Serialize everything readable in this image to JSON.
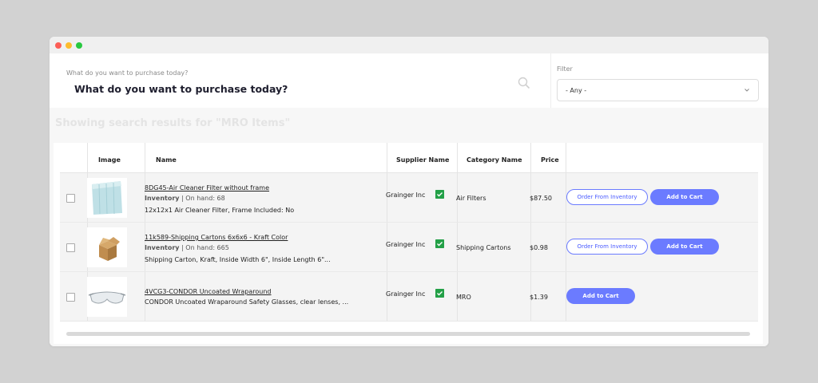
{
  "window": {
    "controls": [
      {
        "name": "close",
        "color": "#fc5e57"
      },
      {
        "name": "minimize",
        "color": "#fdbc2e"
      },
      {
        "name": "zoom",
        "color": "#28c840"
      }
    ]
  },
  "search": {
    "label": "What do you want to purchase today?",
    "value": "What do you want to purchase today?",
    "icon": "search-icon"
  },
  "filter": {
    "label": "Filter",
    "selected": "- Any -"
  },
  "results_title": "Showing search results for \"MRO Items\"",
  "table": {
    "headers": {
      "image": "Image",
      "name": "Name",
      "supplier": "Supplier Name",
      "category": "Category Name",
      "price": "Price"
    },
    "rows": [
      {
        "title": "8DG45-Air Cleaner Filter without frame",
        "inventory_label": "Inventory",
        "inventory_detail": " | On hand: 68",
        "description": "12x12x1 Air Cleaner Filter, Frame Included: No",
        "supplier": "Grainger Inc",
        "category": "Air Filters",
        "price": "$87.50",
        "order_label": "Order From Inventory",
        "cart_label": "Add to Cart"
      },
      {
        "title": "11k589-Shipping Cartons 6x6x6 - Kraft Color",
        "inventory_label": "Inventory",
        "inventory_detail": " | On hand: 665",
        "description": "Shipping Carton, Kraft, Inside Width 6\", Inside Length 6\"...",
        "supplier": "Grainger Inc",
        "category": "Shipping Cartons",
        "price": "$0.98",
        "order_label": "Order From Inventory",
        "cart_label": "Add to Cart"
      },
      {
        "title": "4VCG3-CONDOR Uncoated Wraparound",
        "description": "CONDOR Uncoated Wraparound Safety Glasses, clear lenses, ...",
        "supplier": "Grainger Inc",
        "category": "MRO",
        "price": "$1.39",
        "cart_label": "Add to Cart"
      }
    ]
  },
  "colors": {
    "accent": "#6b7bff",
    "check": "#23a047"
  }
}
